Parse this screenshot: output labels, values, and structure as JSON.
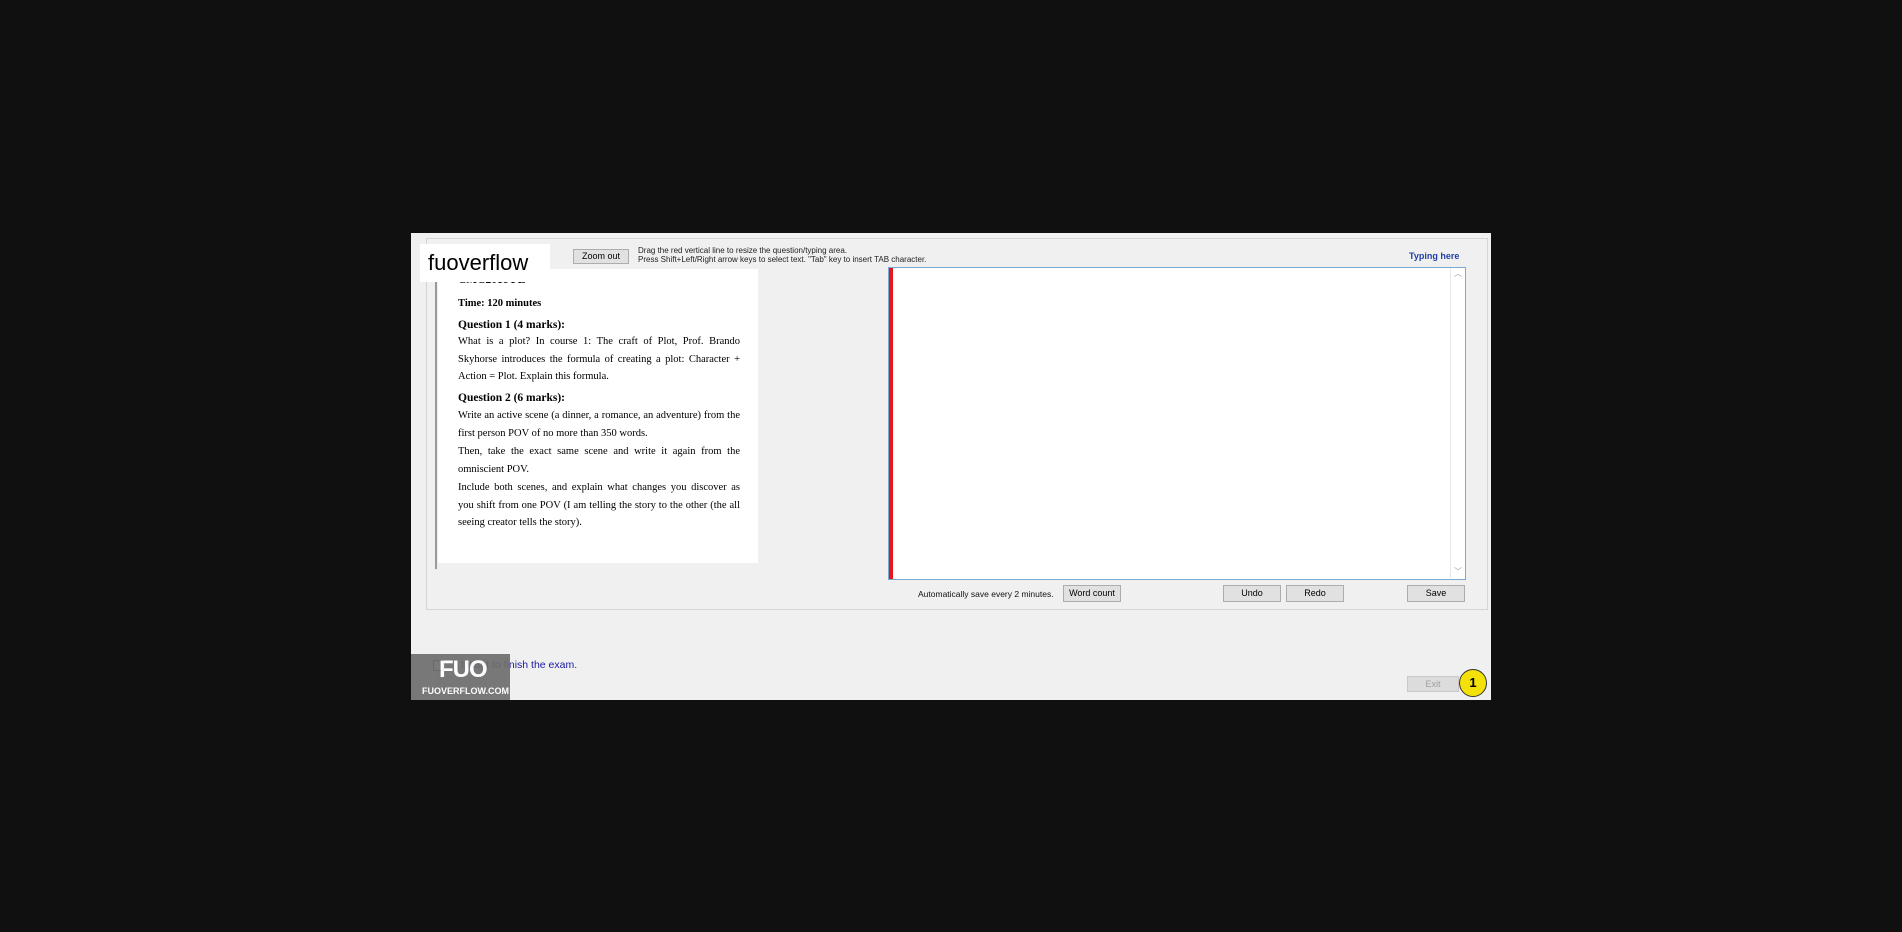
{
  "toolbar": {
    "zoom_out_label": "Zoom out",
    "hint_line1": "Drag the red vertical line to resize the question/typing area.",
    "hint_line2": "Press Shift+Left/Right arrow keys to select text. \"Tab\" key to insert TAB character.",
    "typing_here_label": "Typing here"
  },
  "watermark": {
    "text": "fuoverflow"
  },
  "question": {
    "course_code": "CMC201c FE",
    "time": "Time: 120 minutes",
    "q1_title": "Question 1 (4 marks):",
    "q1_body": "What is a plot? In course 1: The craft of Plot, Prof. Brando Skyhorse introduces the formula of creating a plot: Character + Action = Plot. Explain this formula.",
    "q2_title": "Question 2 (6 marks):",
    "q2_para1": "Write an active scene (a dinner, a romance, an adventure) from the first person POV of no more than 350 words.",
    "q2_para2": "Then, take the exact same scene and write it again from the omniscient POV.",
    "q2_para3": "Include both scenes, and explain what changes you discover as you shift from one POV (I am telling the story to the other (the all seeing creator tells the story)."
  },
  "answer": {
    "text": ""
  },
  "status_bar": {
    "autosave_text": "Automatically save every 2 minutes.",
    "word_count_label": "Word count",
    "undo_label": "Undo",
    "redo_label": "Redo",
    "save_label": "Save"
  },
  "footer": {
    "finish_text": "I want to finish the exam.",
    "exit_label": "Exit",
    "logo_text": "FUO",
    "logo_site": "FUOVERFLOW.COM",
    "badge_number": "1"
  },
  "colors": {
    "divider": "#e3161c",
    "typing_here": "#1f3fa8",
    "badge": "#f5e10a"
  }
}
